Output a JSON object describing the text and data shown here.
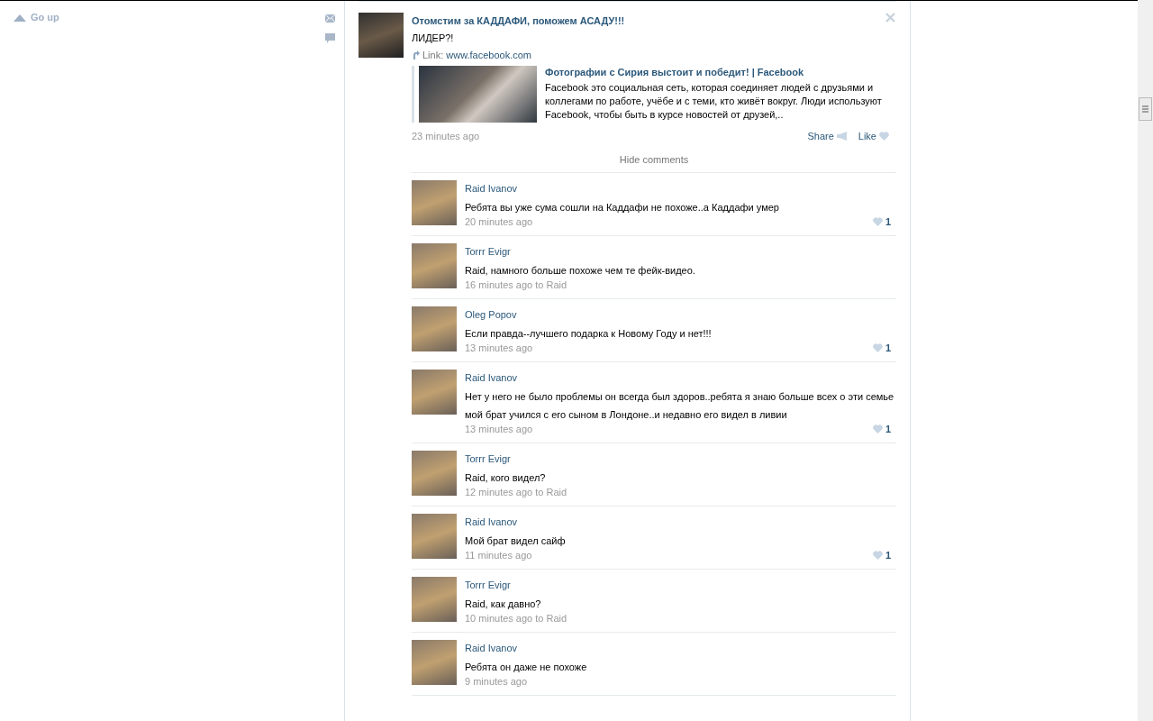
{
  "sidebar": {
    "go_up": "Go up"
  },
  "post": {
    "title": "Отомстим за КАДДАФИ, поможем АСАДУ!!!",
    "text": "ЛИДЕР?!",
    "link_label": "Link:",
    "link_url": "www.facebook.com",
    "preview": {
      "title": "Фотографии с Сирия выстоит и победит! | Facebook",
      "description": "Facebook это социальная сеть, которая соединяет людей с друзьями и коллегами по работе, учёбе и с теми, кто живёт вокруг. Люди используют Facebook, чтобы быть в курсе новостей от друзей,.."
    },
    "time": "23 minutes ago",
    "share": "Share",
    "like": "Like",
    "hide_comments": "Hide comments"
  },
  "comments": [
    {
      "author": "Raid Ivanov",
      "text": "Ребята вы уже сума сошли на Каддафи не похоже..а Каддафи умер",
      "time": "20 minutes ago",
      "likes": "1"
    },
    {
      "author": "Torrr Evigr",
      "text": "Raid, намного больше похоже чем те фейк-видео.",
      "time": "16 minutes ago to Raid"
    },
    {
      "author": "Oleg Popov",
      "text": "Если правда--лучшего подарка к Новому Году и нет!!!",
      "time": "13 minutes ago",
      "likes": "1"
    },
    {
      "author": "Raid Ivanov",
      "text": "Нет у него не было проблемы он всегда был здоров..ребята я знаю больше всех о эти семье мой брат учился с его сыном в Лондоне..и недавно его видел в ливии",
      "time": "13 minutes ago",
      "likes": "1"
    },
    {
      "author": "Torrr Evigr",
      "text": "Raid, кого видел?",
      "time": "12 minutes ago to Raid"
    },
    {
      "author": "Raid Ivanov",
      "text": "Мой брат видел сайф",
      "time": "11 minutes ago",
      "likes": "1"
    },
    {
      "author": "Torrr Evigr",
      "text": "Raid, как давно?",
      "time": "10 minutes ago to Raid"
    },
    {
      "author": "Raid Ivanov",
      "text": "Ребята он даже не похоже",
      "time": "9 minutes ago"
    }
  ]
}
